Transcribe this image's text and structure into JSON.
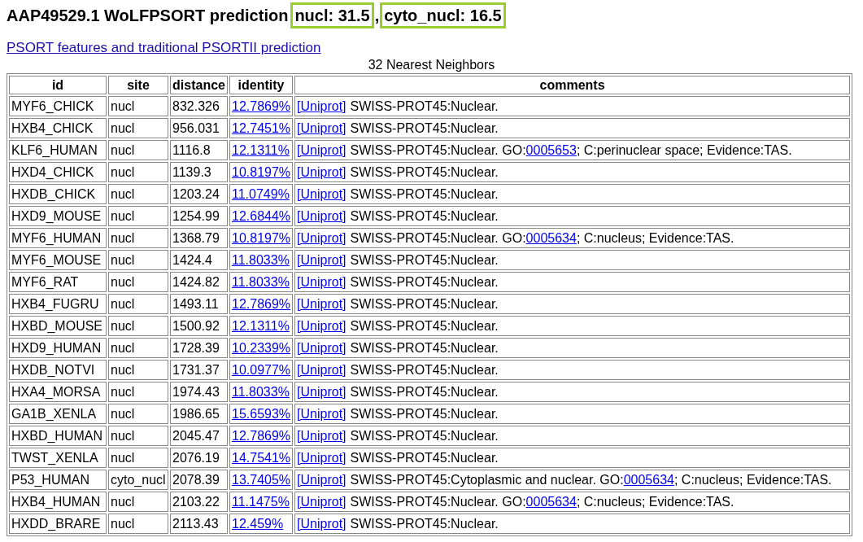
{
  "heading": {
    "title": "AAP49529.1 WoLFPSORT prediction",
    "predictions": [
      {
        "text": "nucl: 31.5",
        "highlighted": true
      },
      {
        "text": "cyto_nucl: 16.5",
        "highlighted": true
      }
    ],
    "separator": ","
  },
  "link": "PSORT features and traditional PSORTII prediction",
  "table": {
    "caption": "32 Nearest Neighbors",
    "columns": [
      "id",
      "site",
      "distance",
      "identity",
      "comments"
    ],
    "rows": [
      {
        "id": "MYF6_CHICK",
        "site": "nucl",
        "distance": "832.326",
        "identity": "12.7869%",
        "source": "[Uniprot]",
        "comment": "SWISS-PROT45:Nuclear."
      },
      {
        "id": "HXB4_CHICK",
        "site": "nucl",
        "distance": "956.031",
        "identity": "12.7451%",
        "source": "[Uniprot]",
        "comment": "SWISS-PROT45:Nuclear."
      },
      {
        "id": "KLF6_HUMAN",
        "site": "nucl",
        "distance": "1116.8",
        "identity": "12.1311%",
        "source": "[Uniprot]",
        "comment": "SWISS-PROT45:Nuclear. GO:",
        "go": "0005653",
        "comment_end": "; C:perinuclear space; Evidence:TAS."
      },
      {
        "id": "HXD4_CHICK",
        "site": "nucl",
        "distance": "1139.3",
        "identity": "10.8197%",
        "source": "[Uniprot]",
        "comment": "SWISS-PROT45:Nuclear."
      },
      {
        "id": "HXDB_CHICK",
        "site": "nucl",
        "distance": "1203.24",
        "identity": "11.0749%",
        "source": "[Uniprot]",
        "comment": "SWISS-PROT45:Nuclear."
      },
      {
        "id": "HXD9_MOUSE",
        "site": "nucl",
        "distance": "1254.99",
        "identity": "12.6844%",
        "source": "[Uniprot]",
        "comment": "SWISS-PROT45:Nuclear."
      },
      {
        "id": "MYF6_HUMAN",
        "site": "nucl",
        "distance": "1368.79",
        "identity": "10.8197%",
        "source": "[Uniprot]",
        "comment": "SWISS-PROT45:Nuclear. GO:",
        "go": "0005634",
        "comment_end": "; C:nucleus; Evidence:TAS."
      },
      {
        "id": "MYF6_MOUSE",
        "site": "nucl",
        "distance": "1424.4",
        "identity": "11.8033%",
        "source": "[Uniprot]",
        "comment": "SWISS-PROT45:Nuclear."
      },
      {
        "id": "MYF6_RAT",
        "site": "nucl",
        "distance": "1424.82",
        "identity": "11.8033%",
        "source": "[Uniprot]",
        "comment": "SWISS-PROT45:Nuclear."
      },
      {
        "id": "HXB4_FUGRU",
        "site": "nucl",
        "distance": "1493.11",
        "identity": "12.7869%",
        "source": "[Uniprot]",
        "comment": "SWISS-PROT45:Nuclear."
      },
      {
        "id": "HXBD_MOUSE",
        "site": "nucl",
        "distance": "1500.92",
        "identity": "12.1311%",
        "source": "[Uniprot]",
        "comment": "SWISS-PROT45:Nuclear."
      },
      {
        "id": "HXD9_HUMAN",
        "site": "nucl",
        "distance": "1728.39",
        "identity": "10.2339%",
        "source": "[Uniprot]",
        "comment": "SWISS-PROT45:Nuclear."
      },
      {
        "id": "HXDB_NOTVI",
        "site": "nucl",
        "distance": "1731.37",
        "identity": "10.0977%",
        "source": "[Uniprot]",
        "comment": "SWISS-PROT45:Nuclear."
      },
      {
        "id": "HXA4_MORSA",
        "site": "nucl",
        "distance": "1974.43",
        "identity": "11.8033%",
        "source": "[Uniprot]",
        "comment": "SWISS-PROT45:Nuclear."
      },
      {
        "id": "GA1B_XENLA",
        "site": "nucl",
        "distance": "1986.65",
        "identity": "15.6593%",
        "source": "[Uniprot]",
        "comment": "SWISS-PROT45:Nuclear."
      },
      {
        "id": "HXBD_HUMAN",
        "site": "nucl",
        "distance": "2045.47",
        "identity": "12.7869%",
        "source": "[Uniprot]",
        "comment": "SWISS-PROT45:Nuclear."
      },
      {
        "id": "TWST_XENLA",
        "site": "nucl",
        "distance": "2076.19",
        "identity": "14.7541%",
        "source": "[Uniprot]",
        "comment": "SWISS-PROT45:Nuclear."
      },
      {
        "id": "P53_HUMAN",
        "site": "cyto_nucl",
        "distance": "2078.39",
        "identity": "13.7405%",
        "source": "[Uniprot]",
        "comment": "SWISS-PROT45:Cytoplasmic and nuclear. GO:",
        "go_term": "0005634",
        "comment_end": "; C:nucleus; Evidence:TAS."
      },
      {
        "id": "HXB4_HUMAN",
        "site": "nucl",
        "distance": "2103.22",
        "identity": "11.1475%",
        "source": "[Uniprot]",
        "comment": "SWISS-PROT45:Nuclear. GO:",
        "go": "0005634",
        "comment_end": "; C:nucleus; Evidence:TAS."
      },
      {
        "id": "HXDD_BRARE",
        "site": "nucl",
        "distance": "2113.43",
        "identity": "12.459%",
        "source": "[Uniprot]",
        "comment": "SWISS-PROT45:Nuclear."
      }
    ]
  }
}
